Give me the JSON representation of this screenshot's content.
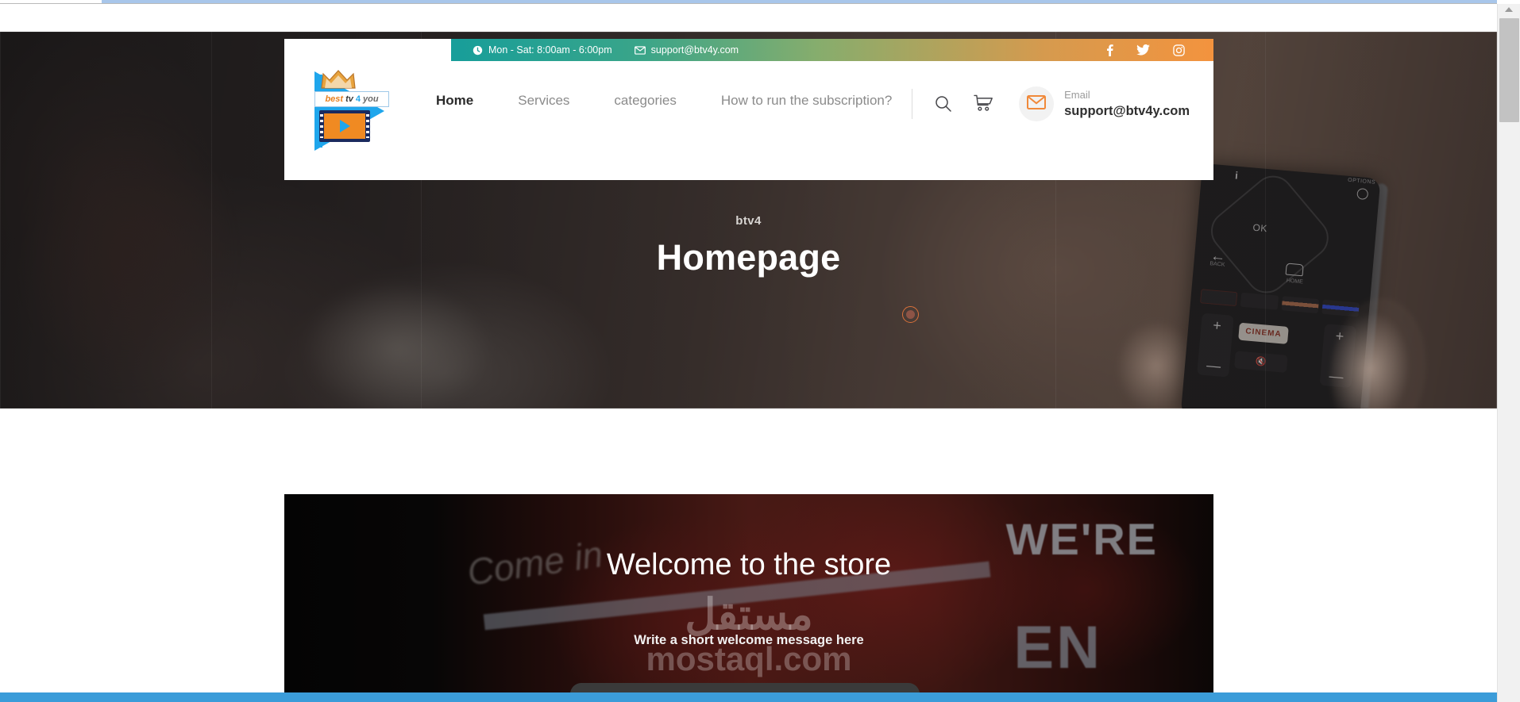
{
  "site": {
    "logo": {
      "best": "best",
      "tv": "tv",
      "four": "4",
      "you": "you",
      "alt": "best tv 4 you"
    },
    "topbar": {
      "hours_icon": "clock-icon",
      "hours": "Mon - Sat: 8:00am - 6:00pm",
      "email_icon": "envelope-icon",
      "email": "support@btv4y.com",
      "social": [
        {
          "name": "facebook-icon",
          "glyph": "f"
        },
        {
          "name": "twitter-icon",
          "glyph": "t"
        },
        {
          "name": "instagram-icon",
          "glyph": "i"
        }
      ],
      "gradient_from": "#179e9a",
      "gradient_to": "#f3933e"
    },
    "nav": {
      "items": [
        {
          "label": "Home",
          "active": true
        },
        {
          "label": "Services",
          "active": false
        },
        {
          "label": "categories",
          "active": false
        },
        {
          "label": "How to run the subscription?",
          "active": false
        }
      ],
      "search_icon": "search-icon",
      "cart_icon": "shopping-cart-icon",
      "contact": {
        "icon": "envelope-icon",
        "label": "Email",
        "value": "support@btv4y.com",
        "icon_color": "#f0893a"
      }
    }
  },
  "hero": {
    "breadcrumb": "btv4",
    "title": "Homepage",
    "marker_icon": "circle-marker-icon",
    "marker_color": "#d9713a"
  },
  "welcome": {
    "title": "Welcome to the store",
    "subtitle": "Write a short welcome message here",
    "watermark_arabic": "مستقل",
    "watermark_latin": "mostaql.com",
    "sign_text_primary": "WE'RE",
    "sign_text_secondary": "EN",
    "sign_text_script": "Come in"
  },
  "chrome": {
    "scrollbar_thumb": "scroll-thumb",
    "bottom_bar_color": "#3b9cd9",
    "top_strip_color": "#a8c6ea"
  }
}
